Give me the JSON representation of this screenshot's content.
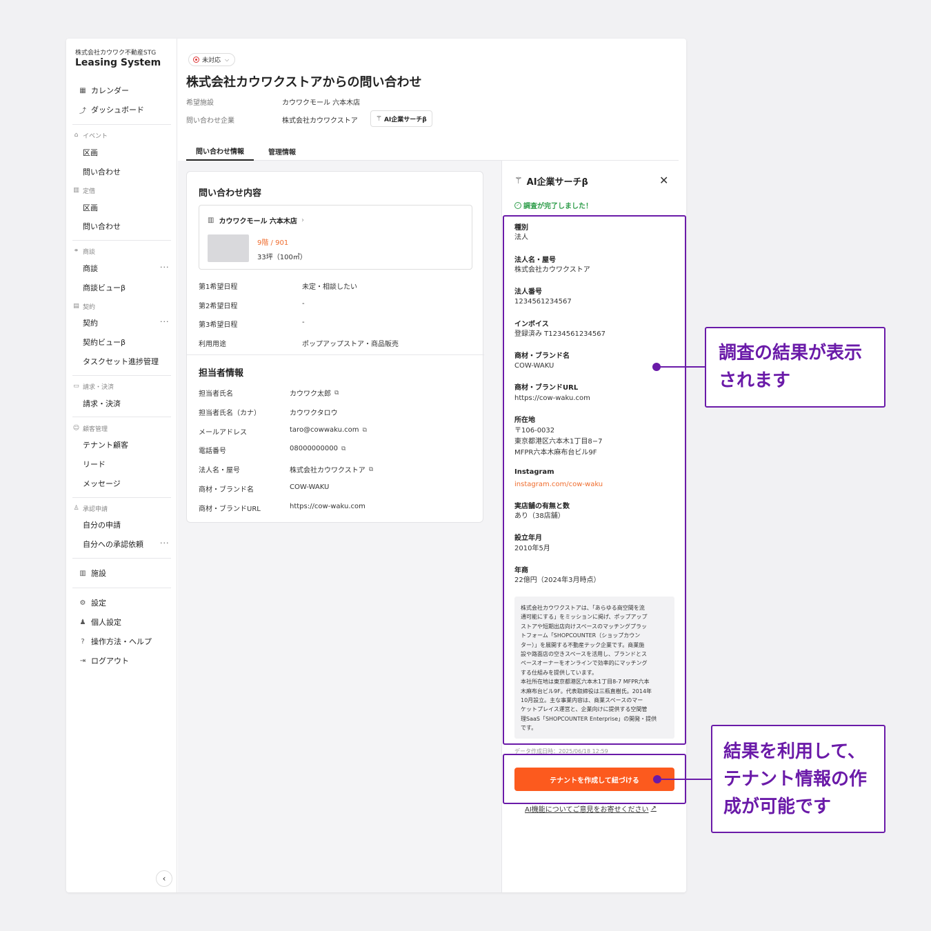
{
  "sidebar": {
    "org": "株式会社カウワク不動産STG",
    "app_name": "Leasing System",
    "top_items": [
      {
        "label": "カレンダー",
        "icon": "calendar-icon"
      },
      {
        "label": "ダッシュボード",
        "icon": "chart-icon"
      }
    ],
    "sections": {
      "event": {
        "label": "イベント",
        "items": [
          "区画",
          "問い合わせ"
        ]
      },
      "fixed": {
        "label": "定借",
        "items": [
          "区画",
          "問い合わせ"
        ]
      },
      "deal": {
        "label": "商談",
        "items": [
          "商談",
          "商談ビューβ"
        ]
      },
      "contract": {
        "label": "契約",
        "items": [
          "契約",
          "契約ビューβ",
          "タスクセット進捗管理"
        ]
      },
      "billing": {
        "label": "請求・決済",
        "items": [
          "請求・決済"
        ]
      },
      "customer": {
        "label": "顧客管理",
        "items": [
          "テナント顧客",
          "リード",
          "メッセージ"
        ]
      },
      "approval": {
        "label": "承認申請",
        "items": [
          "自分の申請",
          "自分への承認依頼"
        ]
      }
    },
    "facility": "施設",
    "bottom_items": [
      "設定",
      "個人設定",
      "操作方法・ヘルプ",
      "ログアウト"
    ],
    "more_label": "···",
    "collapse_icon": "‹"
  },
  "header": {
    "status": "未対応",
    "title": "株式会社カウワクストアからの問い合わせ",
    "facility_label": "希望施設",
    "facility_value": "カウワクモール 六本木店",
    "company_label": "問い合わせ企業",
    "company_value": "株式会社カウワクストア",
    "ai_button": "AI企業サーチβ"
  },
  "tabs": [
    "問い合わせ情報",
    "管理情報"
  ],
  "inquiry": {
    "heading": "問い合わせ内容",
    "property_name": "カウワクモール 六本木店",
    "floor": "9階 / 901",
    "size": "33坪（100㎡）",
    "rows": [
      {
        "label": "第1希望日程",
        "value": "未定・相談したい"
      },
      {
        "label": "第2希望日程",
        "value": "-"
      },
      {
        "label": "第3希望日程",
        "value": "-"
      },
      {
        "label": "利用用途",
        "value": "ポップアップストア・商品販売"
      }
    ]
  },
  "contact": {
    "heading": "担当者情報",
    "rows": [
      {
        "label": "担当者氏名",
        "value": "カウワク太郎",
        "copy": true
      },
      {
        "label": "担当者氏名（カナ）",
        "value": "カウワクタロウ",
        "copy": false
      },
      {
        "label": "メールアドレス",
        "value": "taro@cowwaku.com",
        "copy": true
      },
      {
        "label": "電話番号",
        "value": "08000000000",
        "copy": true
      },
      {
        "label": "法人名・屋号",
        "value": "株式会社カウワクストア",
        "copy": true
      },
      {
        "label": "商材・ブランド名",
        "value": "COW-WAKU",
        "copy": false
      },
      {
        "label": "商材・ブランドURL",
        "value": "https://cow-waku.com",
        "copy": false
      }
    ]
  },
  "panel": {
    "title": "AI企業サーチβ",
    "done": "調査が完了しました！",
    "fields": [
      {
        "label": "種別",
        "value": "法人"
      },
      {
        "label": "法人名・屋号",
        "value": "株式会社カウワクストア"
      },
      {
        "label": "法人番号",
        "value": "1234561234567"
      },
      {
        "label": "インボイス",
        "value": "登録済み T1234561234567"
      },
      {
        "label": "商材・ブランド名",
        "value": "COW-WAKU"
      },
      {
        "label": "商材・ブランドURL",
        "value": "https://cow-waku.com"
      }
    ],
    "address_label": "所在地",
    "address_lines": [
      "〒106-0032",
      "東京都港区六本木1丁目8−7",
      "MFPR六本木麻布台ビル9F"
    ],
    "fields2": [
      {
        "label": "Instagram",
        "value": "instagram.com/cow-waku"
      },
      {
        "label": "実店舗の有無と数",
        "value": "あり（38店舗）"
      },
      {
        "label": "設立年月",
        "value": "2010年5月"
      },
      {
        "label": "年商",
        "value": "22億円（2024年3月時点）"
      }
    ],
    "description": "株式会社カウワクストアは、「あらゆる商空間を流\n通可能にする」をミッションに掲げ、ポップアップ\nストアや短期出店向けスペースのマッチングプラッ\nトフォーム「SHOPCOUNTER（ショップカウン\nター）」を展開する不動産テック企業です。商業施\n設や路面店の空きスペースを活用し、ブランドとス\nペースオーナーをオンラインで効率的にマッチング\nする仕組みを提供しています。\n本社所在地は東京都港区六本木1丁目8-7 MFPR六本\n木麻布台ビル9F。代表取締役は三瓶直樹氏。2014年\n10月設立。主な事業内容は、商業スペースのマー\nケットプレイス運営と、企業向けに提供する空間管\n理SaaS「SHOPCOUNTER Enterprise」の開発・提供\nです。",
    "created": "データ作成日時：2025/06/18 12:59",
    "cta": "テナントを作成して紐づける",
    "feedback": "AI機能についてご意見をお寄せください"
  },
  "annotations": {
    "callout1": [
      "調査の結果が表示",
      "されます"
    ],
    "callout2": [
      "結果を利用して、",
      "テナント情報の作",
      "成が可能です"
    ],
    "color": "#6a1aa8"
  },
  "colors": {
    "accent": "#fc5a1e",
    "success": "#2e9d4a",
    "status": "#d33333"
  }
}
